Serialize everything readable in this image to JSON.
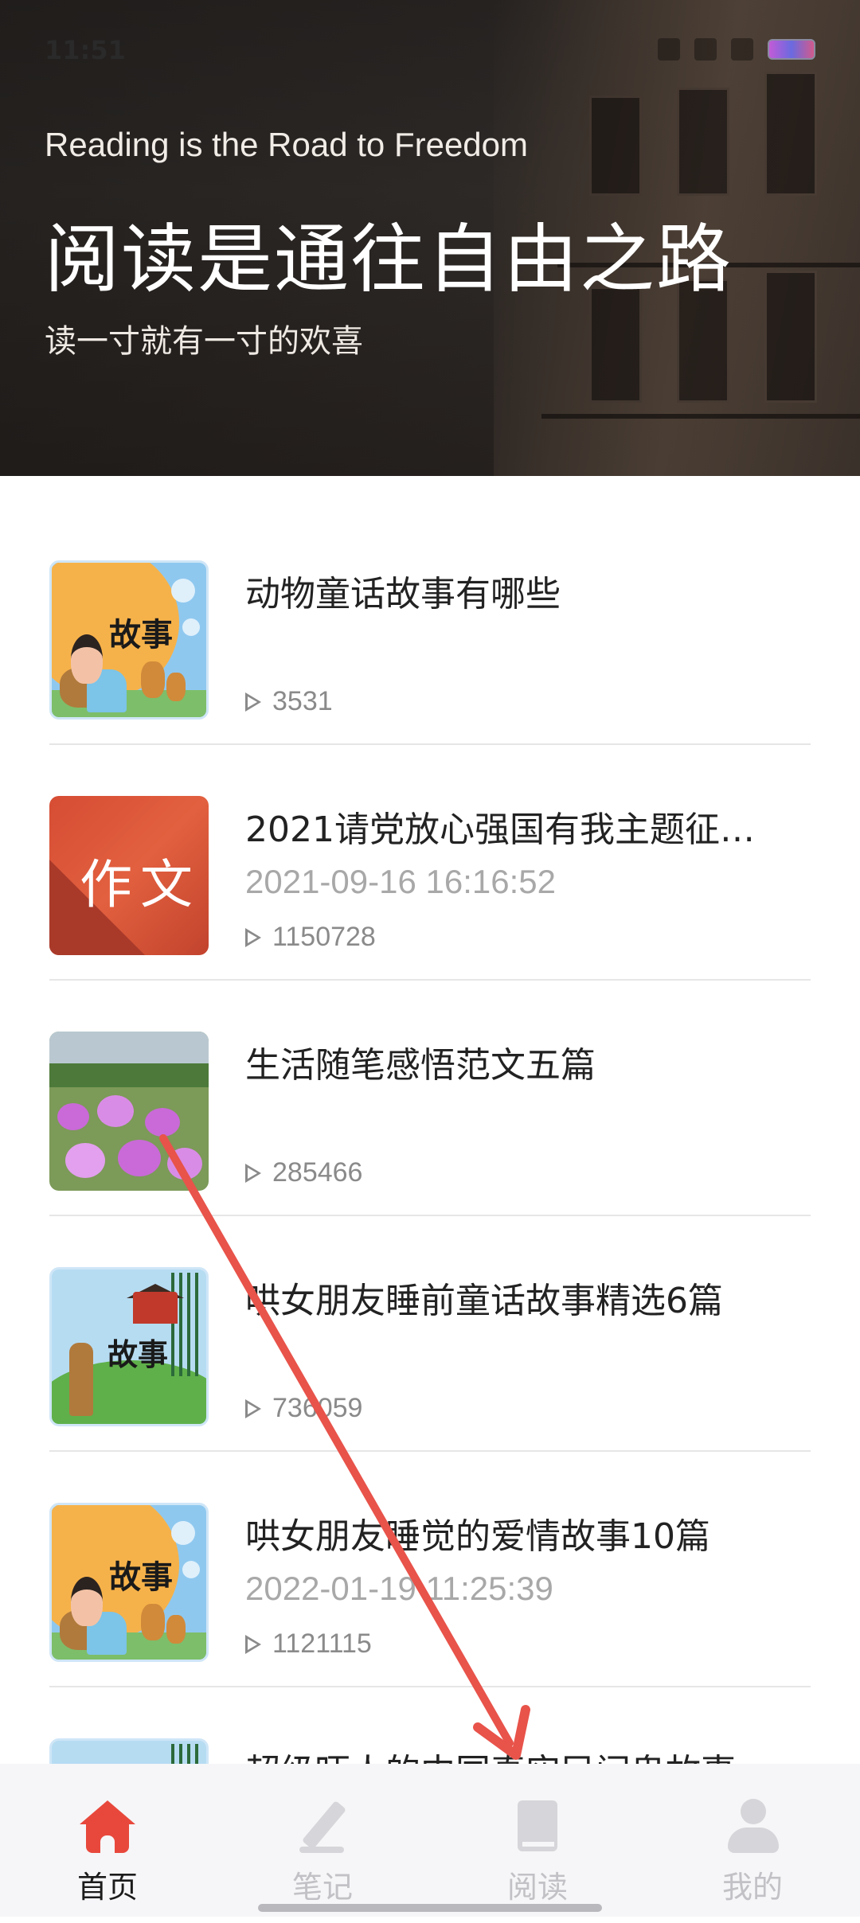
{
  "status_bar": {
    "time": "11:51"
  },
  "hero": {
    "subtitle_en": "Reading is the Road to Freedom",
    "title": "阅读是通往自由之路",
    "tagline": "读一寸就有一寸的欢喜"
  },
  "articles": [
    {
      "title": "动物童话故事有哪些",
      "date": "",
      "views": "3531",
      "thumb": "story",
      "thumb_label": "故事"
    },
    {
      "title": "2021请党放心强国有我主题征…",
      "date": "2021-09-16 16:16:52",
      "views": "1150728",
      "thumb": "essay",
      "thumb_label": "作文"
    },
    {
      "title": "生活随笔感悟范文五篇",
      "date": "",
      "views": "285466",
      "thumb": "flowers",
      "thumb_label": ""
    },
    {
      "title": "哄女朋友睡前童话故事精选6篇",
      "date": "",
      "views": "736059",
      "thumb": "story2",
      "thumb_label": "故事"
    },
    {
      "title": "哄女朋友睡觉的爱情故事10篇",
      "date": "2022-01-19 11:25:39",
      "views": "1121115",
      "thumb": "story",
      "thumb_label": "故事"
    },
    {
      "title": "超级吓人的中国真实民间鬼故事…",
      "date": "",
      "views": "",
      "thumb": "story2",
      "thumb_label": ""
    }
  ],
  "bottom_nav": {
    "items": [
      {
        "label": "首页",
        "icon": "home-icon",
        "active": true
      },
      {
        "label": "笔记",
        "icon": "pen-icon",
        "active": false
      },
      {
        "label": "阅读",
        "icon": "book-icon",
        "active": false
      },
      {
        "label": "我的",
        "icon": "user-icon",
        "active": false
      }
    ]
  },
  "colors": {
    "accent": "#e8483c",
    "annotation_arrow": "#e8534a"
  }
}
